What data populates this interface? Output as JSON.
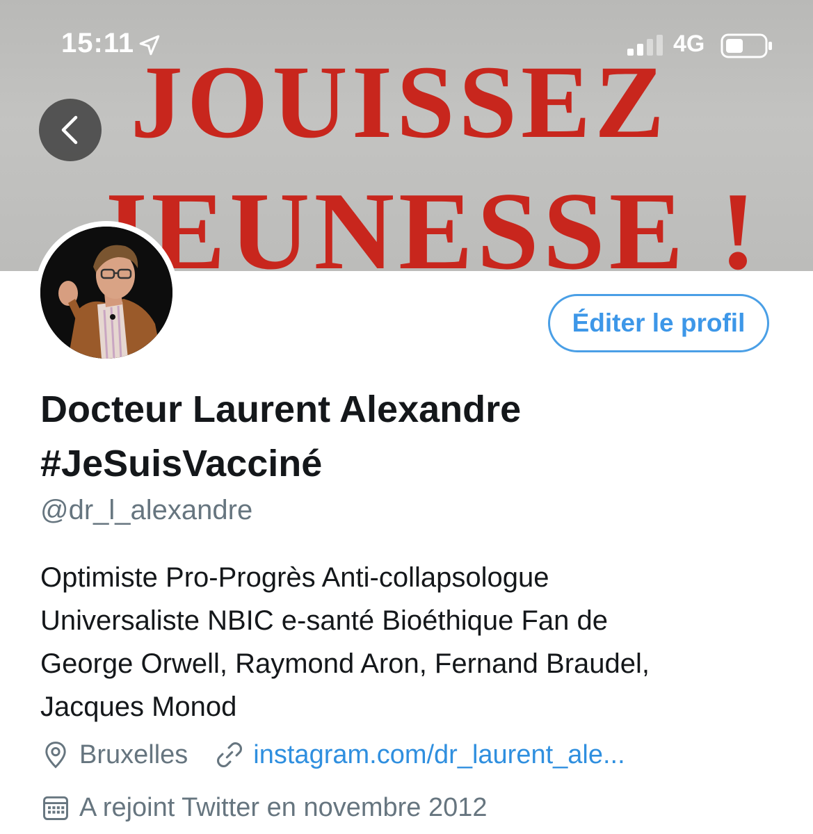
{
  "status_bar": {
    "time": "15:11",
    "network": "4G"
  },
  "banner": {
    "line1": "JOUISSEZ",
    "line2": "JEUNESSE !"
  },
  "profile": {
    "edit_label": "Éditer le profil",
    "display_name_line1": "Docteur Laurent Alexandre",
    "display_name_line2": "#JeSuisVacciné",
    "handle": "@dr_l_alexandre",
    "bio_lines": [
      "Optimiste Pro-Progrès Anti-collapsologue",
      "Universaliste NBIC e-santé Bioéthique Fan de",
      "George Orwell, Raymond Aron, Fernand Braudel,",
      "Jacques Monod"
    ],
    "location": "Bruxelles",
    "website": "instagram.com/dr_laurent_ale...",
    "joined": "A rejoint Twitter en novembre 2012"
  },
  "icons": {
    "back": "chevron-left-icon",
    "location": "location-pin-icon",
    "link": "link-icon",
    "calendar": "calendar-icon",
    "location_arrow": "location-arrow-icon"
  },
  "colors": {
    "accent": "#3d97e8",
    "banner_text": "#c8261d",
    "secondary_text": "#66757f"
  }
}
